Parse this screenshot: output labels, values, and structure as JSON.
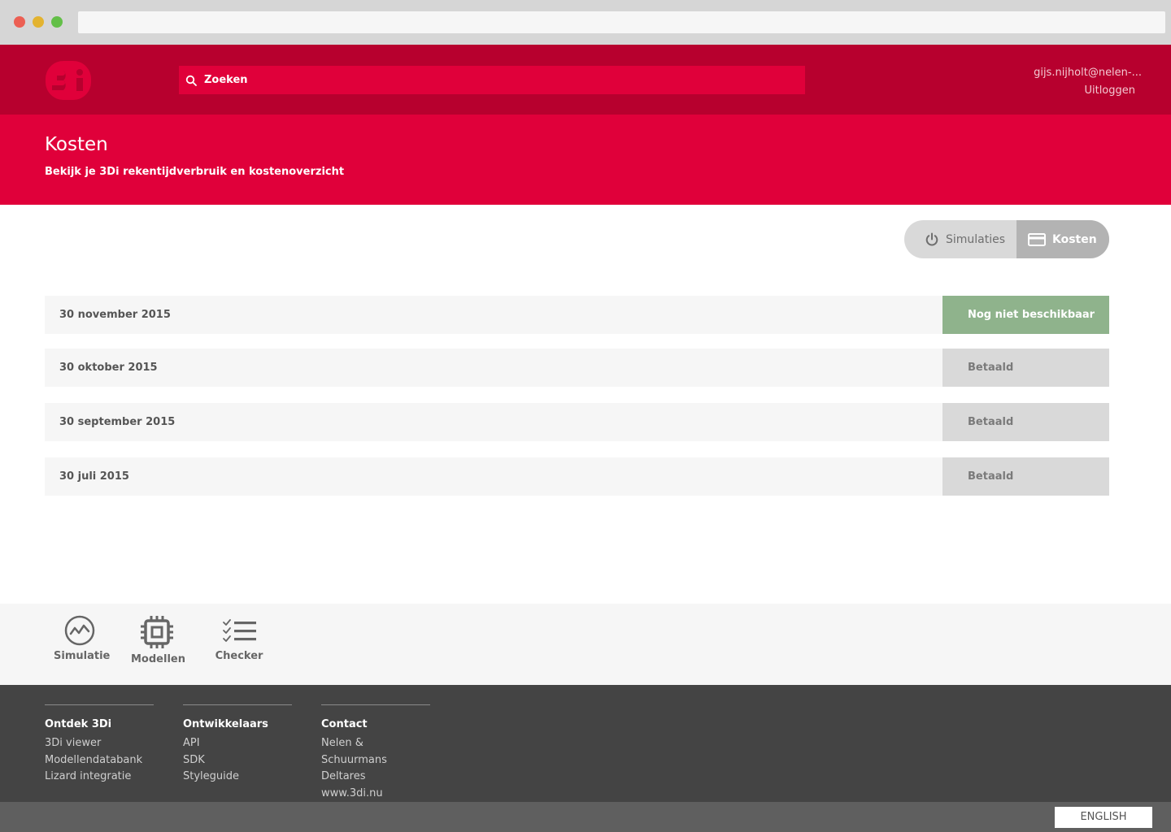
{
  "header": {
    "search_placeholder": "Zoeken",
    "user_email": "gijs.nijholt@nelen-...",
    "logout_label": "Uitloggen",
    "colors": {
      "topbar": "#b7002e",
      "accent": "#e0003a"
    }
  },
  "page": {
    "title": "Kosten",
    "subtitle": "Bekijk je 3Di rekentijdverbruik en kostenoverzicht"
  },
  "toggle": {
    "simulations_label": "Simulaties",
    "costs_label": "Kosten",
    "active": "Kosten"
  },
  "invoices": [
    {
      "date": "30 november 2015",
      "status": "Nog niet beschikbaar"
    },
    {
      "date": "30 oktober 2015",
      "status": "Betaald"
    },
    {
      "date": "30 september 2015",
      "status": "Betaald"
    },
    {
      "date": "30 juli 2015",
      "status": "Betaald"
    }
  ],
  "footer_nav": {
    "items": [
      {
        "label": "Simulatie",
        "icon": "activity-icon"
      },
      {
        "label": "Modellen",
        "icon": "chip-icon"
      },
      {
        "label": "Checker",
        "icon": "checklist-icon"
      }
    ]
  },
  "footer": {
    "columns": [
      {
        "title": "Ontdek 3Di",
        "links": [
          "3Di viewer",
          "Modellendatabank",
          "Lizard integratie"
        ]
      },
      {
        "title": "Ontwikkelaars",
        "links": [
          "API",
          "SDK",
          "Styleguide"
        ]
      },
      {
        "title": "Contact",
        "links": [
          "Nelen & Schuurmans",
          "Deltares",
          "www.3di.nu"
        ]
      }
    ]
  },
  "language_button": "ENGLISH"
}
